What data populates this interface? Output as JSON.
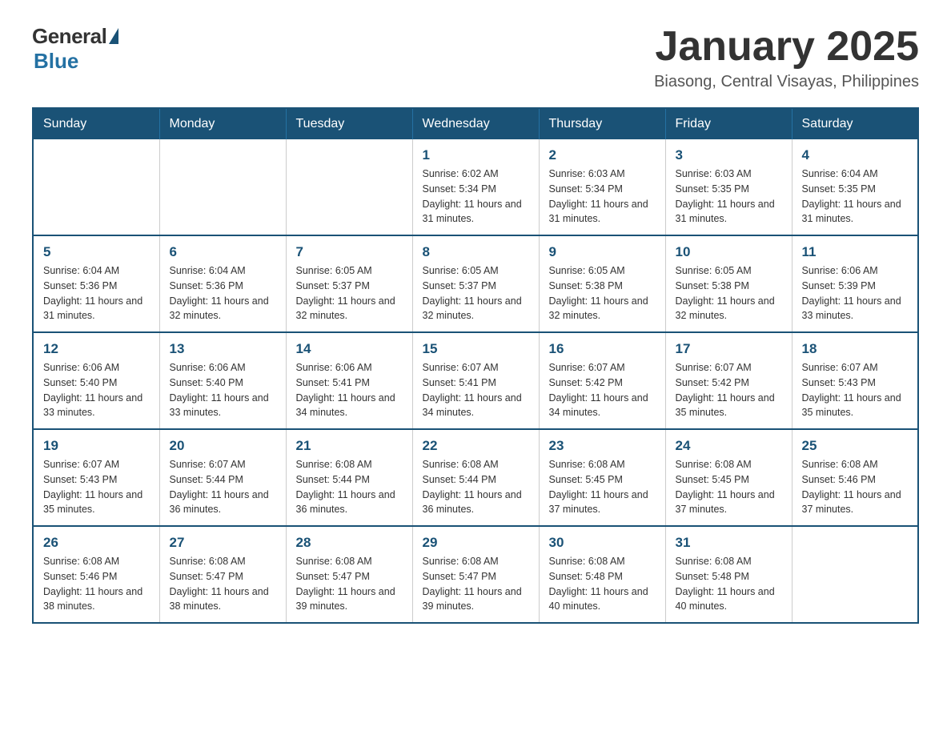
{
  "logo": {
    "general": "General",
    "blue": "Blue"
  },
  "title": "January 2025",
  "location": "Biasong, Central Visayas, Philippines",
  "days_of_week": [
    "Sunday",
    "Monday",
    "Tuesday",
    "Wednesday",
    "Thursday",
    "Friday",
    "Saturday"
  ],
  "weeks": [
    [
      {
        "day": "",
        "info": ""
      },
      {
        "day": "",
        "info": ""
      },
      {
        "day": "",
        "info": ""
      },
      {
        "day": "1",
        "info": "Sunrise: 6:02 AM\nSunset: 5:34 PM\nDaylight: 11 hours and 31 minutes."
      },
      {
        "day": "2",
        "info": "Sunrise: 6:03 AM\nSunset: 5:34 PM\nDaylight: 11 hours and 31 minutes."
      },
      {
        "day": "3",
        "info": "Sunrise: 6:03 AM\nSunset: 5:35 PM\nDaylight: 11 hours and 31 minutes."
      },
      {
        "day": "4",
        "info": "Sunrise: 6:04 AM\nSunset: 5:35 PM\nDaylight: 11 hours and 31 minutes."
      }
    ],
    [
      {
        "day": "5",
        "info": "Sunrise: 6:04 AM\nSunset: 5:36 PM\nDaylight: 11 hours and 31 minutes."
      },
      {
        "day": "6",
        "info": "Sunrise: 6:04 AM\nSunset: 5:36 PM\nDaylight: 11 hours and 32 minutes."
      },
      {
        "day": "7",
        "info": "Sunrise: 6:05 AM\nSunset: 5:37 PM\nDaylight: 11 hours and 32 minutes."
      },
      {
        "day": "8",
        "info": "Sunrise: 6:05 AM\nSunset: 5:37 PM\nDaylight: 11 hours and 32 minutes."
      },
      {
        "day": "9",
        "info": "Sunrise: 6:05 AM\nSunset: 5:38 PM\nDaylight: 11 hours and 32 minutes."
      },
      {
        "day": "10",
        "info": "Sunrise: 6:05 AM\nSunset: 5:38 PM\nDaylight: 11 hours and 32 minutes."
      },
      {
        "day": "11",
        "info": "Sunrise: 6:06 AM\nSunset: 5:39 PM\nDaylight: 11 hours and 33 minutes."
      }
    ],
    [
      {
        "day": "12",
        "info": "Sunrise: 6:06 AM\nSunset: 5:40 PM\nDaylight: 11 hours and 33 minutes."
      },
      {
        "day": "13",
        "info": "Sunrise: 6:06 AM\nSunset: 5:40 PM\nDaylight: 11 hours and 33 minutes."
      },
      {
        "day": "14",
        "info": "Sunrise: 6:06 AM\nSunset: 5:41 PM\nDaylight: 11 hours and 34 minutes."
      },
      {
        "day": "15",
        "info": "Sunrise: 6:07 AM\nSunset: 5:41 PM\nDaylight: 11 hours and 34 minutes."
      },
      {
        "day": "16",
        "info": "Sunrise: 6:07 AM\nSunset: 5:42 PM\nDaylight: 11 hours and 34 minutes."
      },
      {
        "day": "17",
        "info": "Sunrise: 6:07 AM\nSunset: 5:42 PM\nDaylight: 11 hours and 35 minutes."
      },
      {
        "day": "18",
        "info": "Sunrise: 6:07 AM\nSunset: 5:43 PM\nDaylight: 11 hours and 35 minutes."
      }
    ],
    [
      {
        "day": "19",
        "info": "Sunrise: 6:07 AM\nSunset: 5:43 PM\nDaylight: 11 hours and 35 minutes."
      },
      {
        "day": "20",
        "info": "Sunrise: 6:07 AM\nSunset: 5:44 PM\nDaylight: 11 hours and 36 minutes."
      },
      {
        "day": "21",
        "info": "Sunrise: 6:08 AM\nSunset: 5:44 PM\nDaylight: 11 hours and 36 minutes."
      },
      {
        "day": "22",
        "info": "Sunrise: 6:08 AM\nSunset: 5:44 PM\nDaylight: 11 hours and 36 minutes."
      },
      {
        "day": "23",
        "info": "Sunrise: 6:08 AM\nSunset: 5:45 PM\nDaylight: 11 hours and 37 minutes."
      },
      {
        "day": "24",
        "info": "Sunrise: 6:08 AM\nSunset: 5:45 PM\nDaylight: 11 hours and 37 minutes."
      },
      {
        "day": "25",
        "info": "Sunrise: 6:08 AM\nSunset: 5:46 PM\nDaylight: 11 hours and 37 minutes."
      }
    ],
    [
      {
        "day": "26",
        "info": "Sunrise: 6:08 AM\nSunset: 5:46 PM\nDaylight: 11 hours and 38 minutes."
      },
      {
        "day": "27",
        "info": "Sunrise: 6:08 AM\nSunset: 5:47 PM\nDaylight: 11 hours and 38 minutes."
      },
      {
        "day": "28",
        "info": "Sunrise: 6:08 AM\nSunset: 5:47 PM\nDaylight: 11 hours and 39 minutes."
      },
      {
        "day": "29",
        "info": "Sunrise: 6:08 AM\nSunset: 5:47 PM\nDaylight: 11 hours and 39 minutes."
      },
      {
        "day": "30",
        "info": "Sunrise: 6:08 AM\nSunset: 5:48 PM\nDaylight: 11 hours and 40 minutes."
      },
      {
        "day": "31",
        "info": "Sunrise: 6:08 AM\nSunset: 5:48 PM\nDaylight: 11 hours and 40 minutes."
      },
      {
        "day": "",
        "info": ""
      }
    ]
  ]
}
